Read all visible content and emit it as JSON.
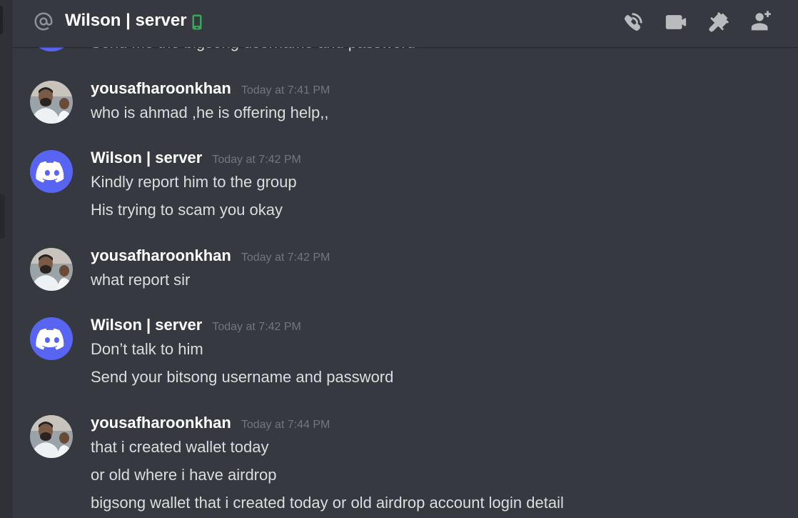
{
  "header": {
    "title": "Wilson | server",
    "icons": [
      "at-icon",
      "mobile-icon",
      "start-voice-call-icon",
      "start-video-call-icon",
      "pinned-messages-icon",
      "add-friends-icon"
    ]
  },
  "colors": {
    "background": "#36393f",
    "sidebar": "#2f3136",
    "blurple": "#5865f2",
    "online_green": "#3ba55d",
    "username": "#ffffff",
    "text": "#dcddde",
    "timestamp": "#72767d",
    "icon": "#b9bbbe"
  },
  "partial_message": "Send me the bigsong username and password",
  "messages": [
    {
      "author": "yousafharoonkhan",
      "timestamp": "Today at 7:41 PM",
      "avatar": "user-photo",
      "lines": [
        "who is ahmad ,he is offering help,,"
      ]
    },
    {
      "author": "Wilson | server",
      "timestamp": "Today at 7:42 PM",
      "avatar": "discord-logo",
      "lines": [
        "Kindly report him to the group",
        "His trying to scam you okay"
      ]
    },
    {
      "author": "yousafharoonkhan",
      "timestamp": "Today at 7:42 PM",
      "avatar": "user-photo",
      "lines": [
        "what report sir"
      ]
    },
    {
      "author": "Wilson | server",
      "timestamp": "Today at 7:42 PM",
      "avatar": "discord-logo",
      "lines": [
        "Don’t talk to him",
        "Send your bitsong username and password"
      ]
    },
    {
      "author": "yousafharoonkhan",
      "timestamp": "Today at 7:44 PM",
      "avatar": "user-photo",
      "lines": [
        "that i created wallet today",
        "or old where i have airdrop",
        "bigsong wallet that i created today or old airdrop account login detail"
      ]
    }
  ]
}
